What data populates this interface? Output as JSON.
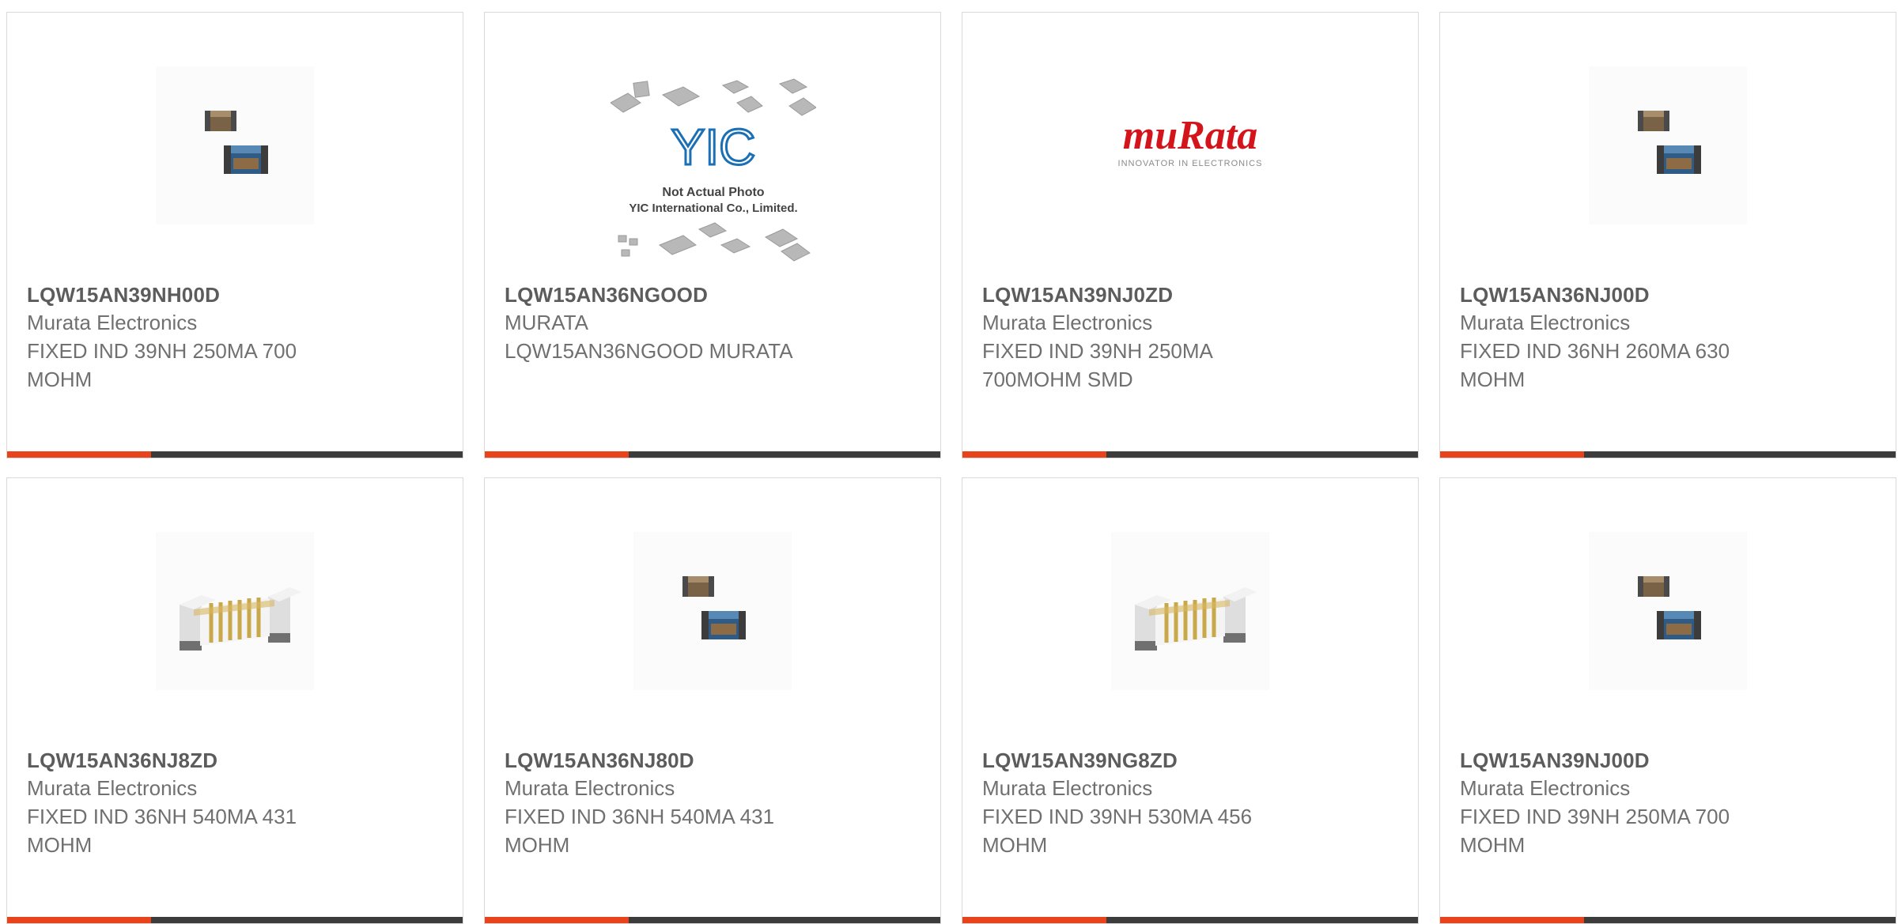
{
  "products": [
    {
      "part_number": "LQW15AN39NH00D",
      "manufacturer": "Murata Electronics",
      "description": "FIXED IND 39NH 250MA 700 MOHM",
      "image": "chip-pair-icon"
    },
    {
      "part_number": "LQW15AN36NGOOD",
      "manufacturer": "MURATA",
      "description": "LQW15AN36NGOOD MURATA",
      "image": "not-actual-photo-placeholder",
      "image_caption_1": "Not Actual Photo",
      "image_caption_2": "YIC International Co., Limited.",
      "image_logo": "YIC"
    },
    {
      "part_number": "LQW15AN39NJ0ZD",
      "manufacturer": "Murata Electronics",
      "description": "FIXED IND 39NH 250MA 700MOHM SMD",
      "image": "murata-logo",
      "logo_text": "muRata",
      "logo_tagline": "INNOVATOR IN ELECTRONICS"
    },
    {
      "part_number": "LQW15AN36NJ00D",
      "manufacturer": "Murata Electronics",
      "description": "FIXED IND 36NH 260MA 630 MOHM",
      "image": "chip-pair-icon"
    },
    {
      "part_number": "LQW15AN36NJ8ZD",
      "manufacturer": "Murata Electronics",
      "description": "FIXED IND 36NH 540MA 431 MOHM",
      "image": "wirewound-inductor-icon"
    },
    {
      "part_number": "LQW15AN36NJ80D",
      "manufacturer": "Murata Electronics",
      "description": "FIXED IND 36NH 540MA 431 MOHM",
      "image": "chip-pair-icon"
    },
    {
      "part_number": "LQW15AN39NG8ZD",
      "manufacturer": "Murata Electronics",
      "description": "FIXED IND 39NH 530MA 456 MOHM",
      "image": "wirewound-inductor-icon"
    },
    {
      "part_number": "LQW15AN39NJ00D",
      "manufacturer": "Murata Electronics",
      "description": "FIXED IND 39NH 250MA 700 MOHM",
      "image": "chip-pair-icon"
    }
  ],
  "colors": {
    "accent": "#e8431a",
    "bar": "#3c3c3c",
    "part_number_text": "#5c5c5c",
    "body_text": "#707070",
    "murata_red": "#d4141b",
    "yic_blue": "#1a6fb5"
  }
}
